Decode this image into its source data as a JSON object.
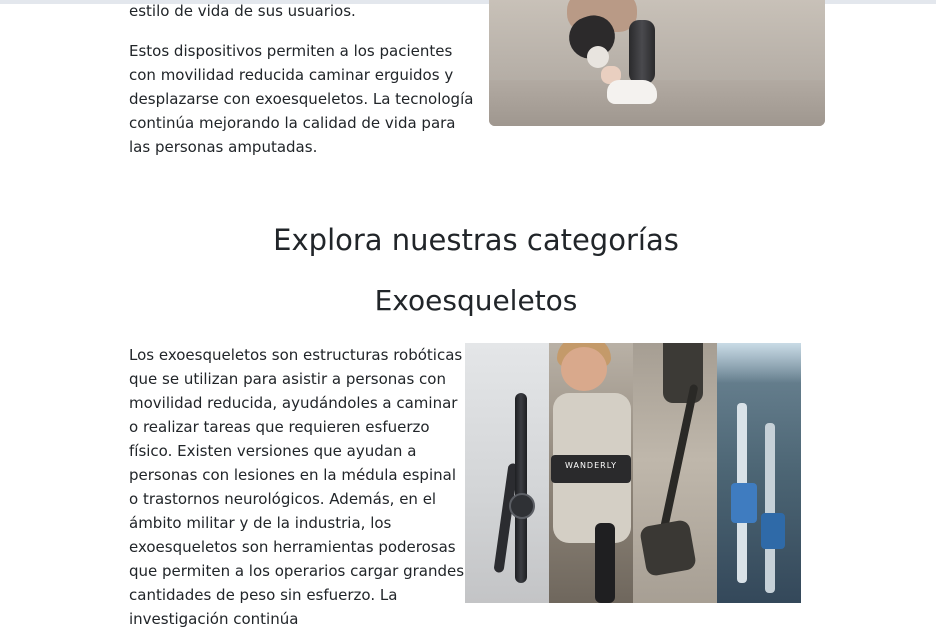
{
  "intro": {
    "paragraph_tail": "estilo de vida de sus usuarios.",
    "paragraph_2": "Estos dispositivos permiten a los pacientes con movilidad reducida caminar erguidos y desplazarse con exoesqueletos. La tecnología continúa mejorando la calidad de vida para las personas amputadas."
  },
  "categories": {
    "heading": "Explora nuestras categorías"
  },
  "exoskeletons": {
    "heading": "Exoesqueletos",
    "paragraph": "Los exoesqueletos son estructuras robóticas que se utilizan para asistir a personas con movilidad reducida, ayudándoles a caminar o realizar tareas que requieren esfuerzo físico. Existen versiones que ayudan a personas con lesiones en la médula espinal o trastornos neurológicos. Además, en el ámbito militar y de la industria, los exoesqueletos son herramientas poderosas que permiten a los operarios cargar grandes cantidades de peso sin esfuerzo. La investigación continúa",
    "image_label": "WANDERLY"
  }
}
